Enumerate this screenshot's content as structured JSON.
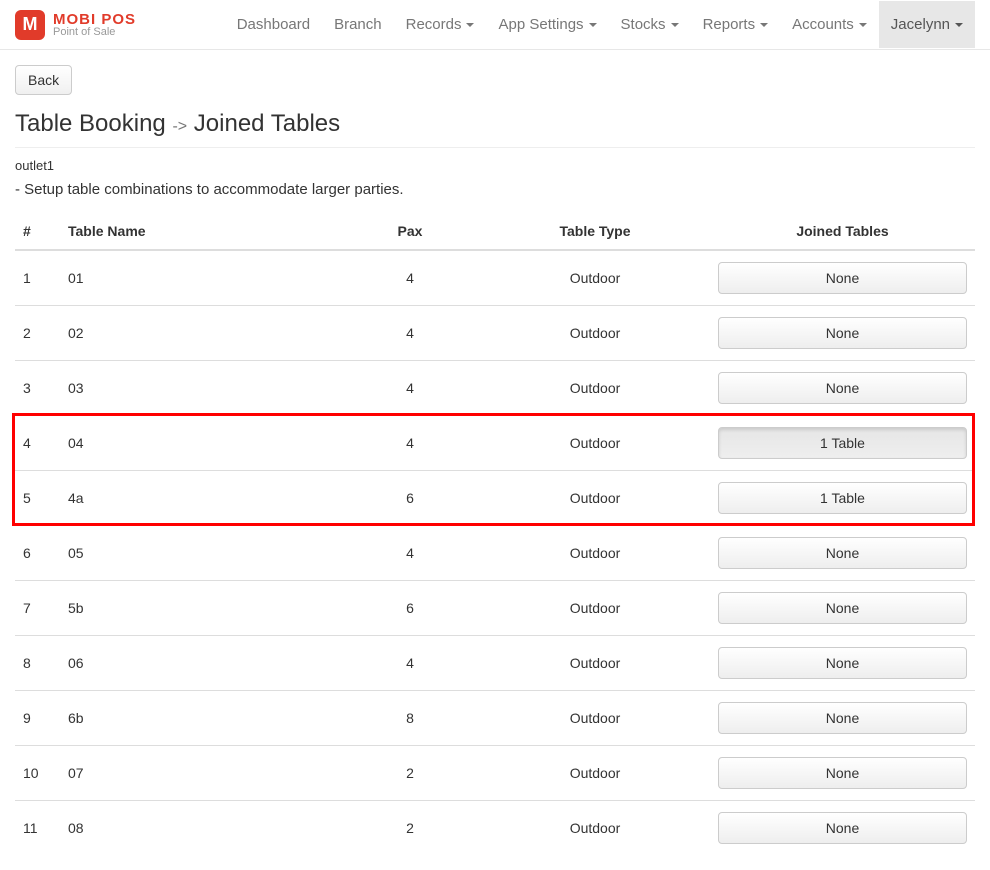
{
  "brand": {
    "title": "MOBI POS",
    "subtitle": "Point of Sale",
    "icon_letter": "M"
  },
  "nav": {
    "dashboard": "Dashboard",
    "branch": "Branch",
    "records": "Records",
    "app_settings": "App Settings",
    "stocks": "Stocks",
    "reports": "Reports",
    "accounts": "Accounts",
    "user": "Jacelynn"
  },
  "back_label": "Back",
  "title_part1": "Table Booking",
  "title_arrow": "->",
  "title_part2": "Joined Tables",
  "outlet": "outlet1",
  "description": "- Setup table combinations to accommodate larger parties.",
  "headers": {
    "num": "#",
    "name": "Table Name",
    "pax": "Pax",
    "type": "Table Type",
    "joined": "Joined Tables"
  },
  "rows": [
    {
      "num": "1",
      "name": "01",
      "pax": "4",
      "type": "Outdoor",
      "joined": "None",
      "pressed": false
    },
    {
      "num": "2",
      "name": "02",
      "pax": "4",
      "type": "Outdoor",
      "joined": "None",
      "pressed": false
    },
    {
      "num": "3",
      "name": "03",
      "pax": "4",
      "type": "Outdoor",
      "joined": "None",
      "pressed": false
    },
    {
      "num": "4",
      "name": "04",
      "pax": "4",
      "type": "Outdoor",
      "joined": "1 Table",
      "pressed": true
    },
    {
      "num": "5",
      "name": "4a",
      "pax": "6",
      "type": "Outdoor",
      "joined": "1 Table",
      "pressed": false
    },
    {
      "num": "6",
      "name": "05",
      "pax": "4",
      "type": "Outdoor",
      "joined": "None",
      "pressed": false
    },
    {
      "num": "7",
      "name": "5b",
      "pax": "6",
      "type": "Outdoor",
      "joined": "None",
      "pressed": false
    },
    {
      "num": "8",
      "name": "06",
      "pax": "4",
      "type": "Outdoor",
      "joined": "None",
      "pressed": false
    },
    {
      "num": "9",
      "name": "6b",
      "pax": "8",
      "type": "Outdoor",
      "joined": "None",
      "pressed": false
    },
    {
      "num": "10",
      "name": "07",
      "pax": "2",
      "type": "Outdoor",
      "joined": "None",
      "pressed": false
    },
    {
      "num": "11",
      "name": "08",
      "pax": "2",
      "type": "Outdoor",
      "joined": "None",
      "pressed": false
    }
  ],
  "highlight_rows": [
    3,
    4
  ]
}
